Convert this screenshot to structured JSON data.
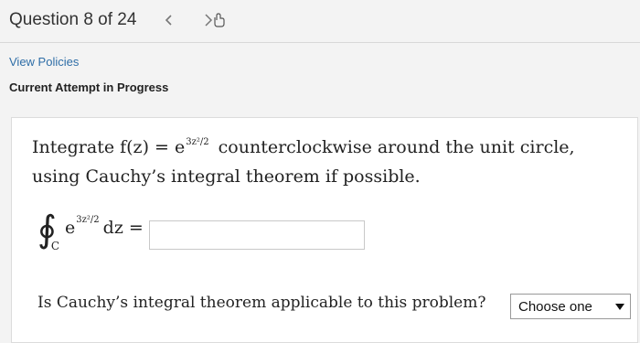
{
  "header": {
    "question_label": "Question 8 of 24",
    "prev_icon": "chevron-left-icon",
    "next_icon": "next-with-cursor-icon"
  },
  "links": {
    "view_policies": "View Policies"
  },
  "status": {
    "attempt": "Current Attempt in Progress"
  },
  "question": {
    "prompt_part1": "Integrate f(z) = e",
    "exponent": "3z²/2",
    "prompt_part2": "counterclockwise around the unit circle, using Cauchy’s integral theorem if possible.",
    "integral_symbol": "∮",
    "contour_label": "C",
    "integral_base": "e",
    "integral_exponent": "3z²/2",
    "integral_tail": "dz =",
    "answer_value": "",
    "applicability_question": "Is Cauchy’s integral theorem applicable to this problem?",
    "select_selected": "Choose one"
  }
}
